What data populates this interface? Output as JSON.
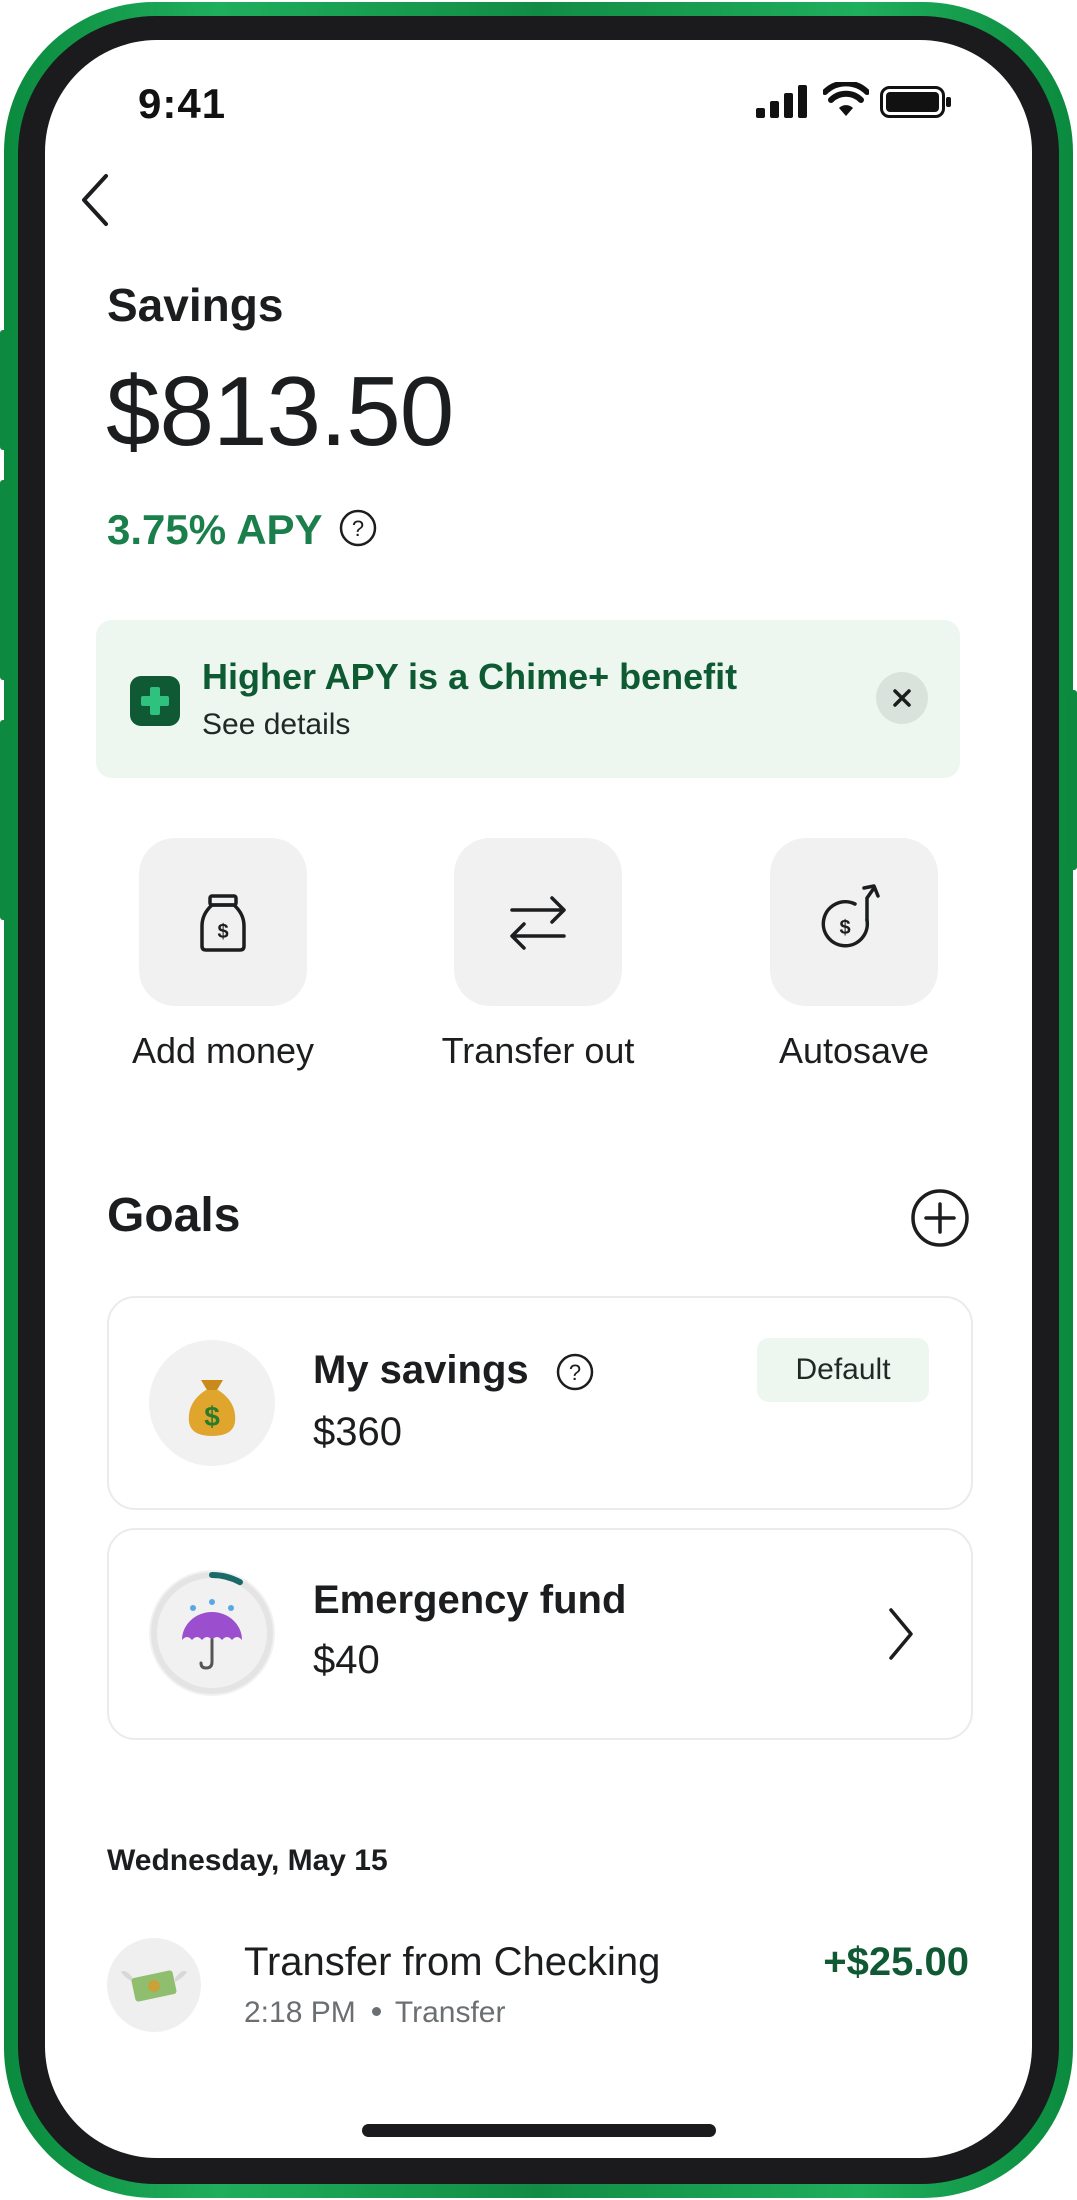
{
  "status_bar": {
    "time": "9:41"
  },
  "header": {
    "title": "Savings",
    "balance": "$813.50",
    "apy": "3.75% APY"
  },
  "promo": {
    "title": "Higher APY is a Chime+ benefit",
    "subtitle": "See details"
  },
  "actions": [
    {
      "label": "Add money",
      "icon": "money-jar-icon"
    },
    {
      "label": "Transfer out",
      "icon": "transfer-arrows-icon"
    },
    {
      "label": "Autosave",
      "icon": "autosave-icon"
    }
  ],
  "goals": {
    "title": "Goals",
    "items": [
      {
        "name": "My savings",
        "amount": "$360",
        "badge": "Default",
        "icon": "money-bag-icon"
      },
      {
        "name": "Emergency fund",
        "amount": "$40",
        "icon": "umbrella-icon",
        "progress_percent": 8
      }
    ]
  },
  "activity": {
    "date": "Wednesday, May 15",
    "transactions": [
      {
        "name": "Transfer from Checking",
        "time": "2:18 PM",
        "type": "Transfer",
        "amount": "+$25.00",
        "icon": "money-with-wings-icon"
      }
    ]
  },
  "colors": {
    "accent": "#1a7f4b",
    "dark_green": "#0f5a34",
    "frame": "#1fae5c"
  }
}
